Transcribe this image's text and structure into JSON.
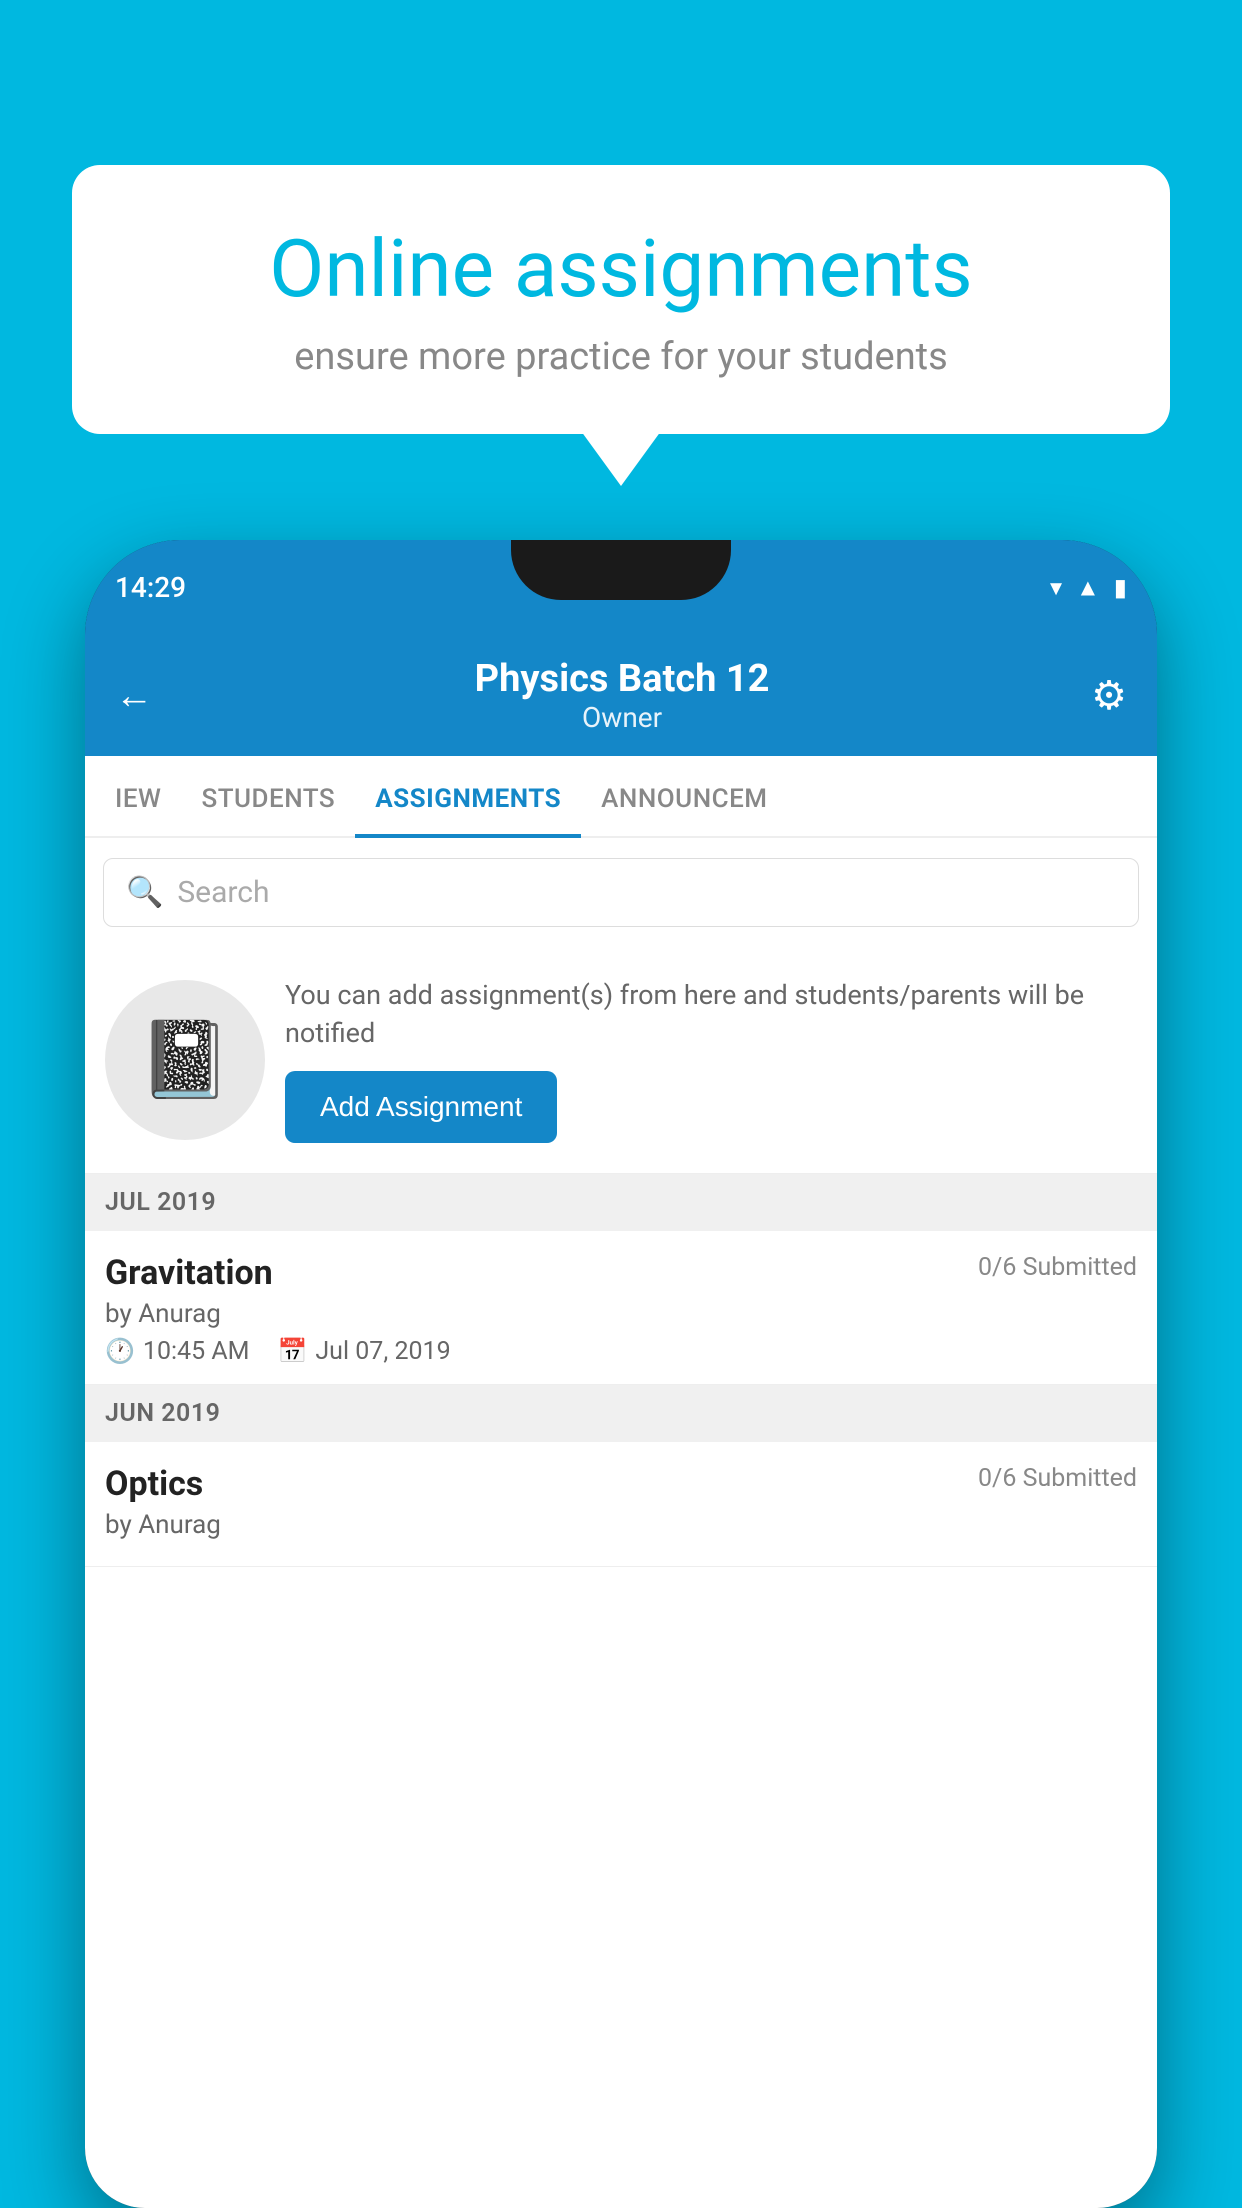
{
  "background_color": "#00B8E0",
  "speech_bubble": {
    "title": "Online assignments",
    "subtitle": "ensure more practice for your students"
  },
  "phone": {
    "status_bar": {
      "time": "14:29"
    },
    "header": {
      "title": "Physics Batch 12",
      "subtitle": "Owner",
      "back_icon": "←",
      "gear_icon": "⚙"
    },
    "tabs": [
      {
        "label": "IEW",
        "active": false
      },
      {
        "label": "STUDENTS",
        "active": false
      },
      {
        "label": "ASSIGNMENTS",
        "active": true
      },
      {
        "label": "ANNOUNCEM",
        "active": false
      }
    ],
    "search": {
      "placeholder": "Search"
    },
    "promo": {
      "text": "You can add assignment(s) from here and students/parents will be notified",
      "button_label": "Add Assignment"
    },
    "sections": [
      {
        "header": "JUL 2019",
        "assignments": [
          {
            "name": "Gravitation",
            "submitted": "0/6 Submitted",
            "by": "by Anurag",
            "time": "10:45 AM",
            "date": "Jul 07, 2019"
          }
        ]
      },
      {
        "header": "JUN 2019",
        "assignments": [
          {
            "name": "Optics",
            "submitted": "0/6 Submitted",
            "by": "by Anurag",
            "time": "",
            "date": ""
          }
        ]
      }
    ]
  }
}
